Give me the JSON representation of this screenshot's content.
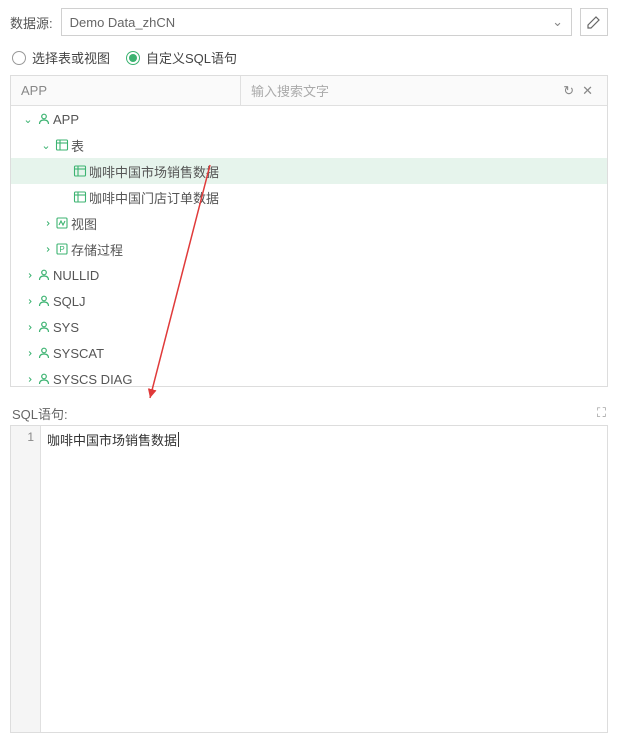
{
  "datasource": {
    "label": "数据源:",
    "value": "Demo Data_zhCN"
  },
  "mode": {
    "option_table_view": "选择表或视图",
    "option_custom_sql": "自定义SQL语句",
    "selected": "custom"
  },
  "tree": {
    "breadcrumb": "APP",
    "search_placeholder": "输入搜索文字",
    "nodes": {
      "app": "APP",
      "tables": "表",
      "table1": "咖啡中国市场销售数据",
      "table2": "咖啡中国门店订单数据",
      "views": "视图",
      "procs": "存储过程",
      "nullid": "NULLID",
      "sqlj": "SQLJ",
      "sys": "SYS",
      "syscat": "SYSCAT",
      "syscs_diag": "SYSCS DIAG"
    }
  },
  "sql": {
    "label": "SQL语句:",
    "line1_no": "1",
    "line1_text": "咖啡中国市场销售数据"
  }
}
